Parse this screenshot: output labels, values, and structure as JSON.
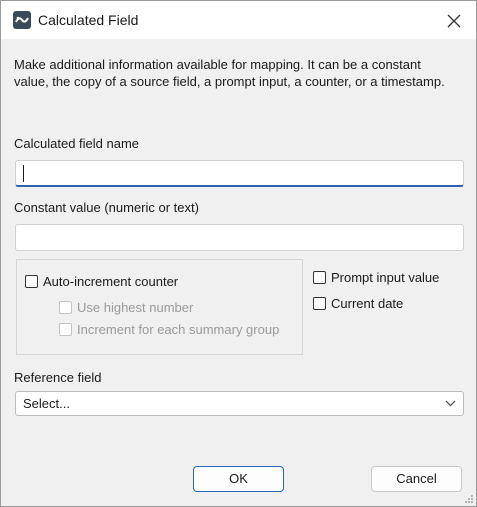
{
  "window": {
    "title": "Calculated Field",
    "app_icon": "app-logo-icon",
    "close_icon": "close-icon"
  },
  "description": "Make additional information available for mapping. It can be a constant value, the copy of a source field, a prompt input, a counter, or a timestamp.",
  "calculated_field_name": {
    "label": "Calculated field name",
    "value": ""
  },
  "constant_value": {
    "label": "Constant value (numeric or text)",
    "value": ""
  },
  "auto_increment": {
    "label": "Auto-increment counter",
    "checked": false,
    "use_highest_number": {
      "label": "Use highest number",
      "checked": false,
      "enabled": false
    },
    "increment_per_group": {
      "label": "Increment for each summary group",
      "checked": false,
      "enabled": false
    }
  },
  "prompt_input": {
    "label": "Prompt input value",
    "checked": false
  },
  "current_date": {
    "label": "Current date",
    "checked": false
  },
  "reference_field": {
    "label": "Reference field",
    "selected": "Select..."
  },
  "buttons": {
    "ok": "OK",
    "cancel": "Cancel"
  },
  "colors": {
    "accent": "#2a64b0",
    "dialog_bg": "#f0f0f0",
    "disabled_text": "#9a9a9a"
  }
}
